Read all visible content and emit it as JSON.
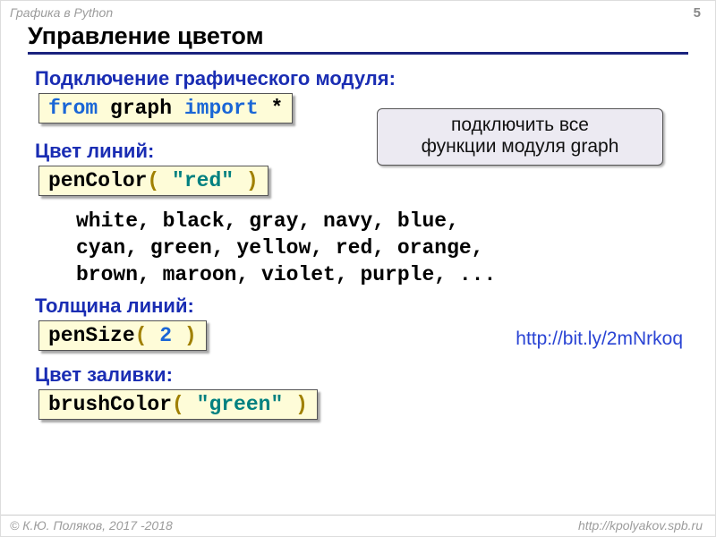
{
  "header": {
    "topic": "Графика в Python",
    "page": "5"
  },
  "title": "Управление цветом",
  "sections": {
    "connect": {
      "label": "Подключение графического модуля:",
      "code": {
        "a": "from",
        "b": " graph ",
        "c": "import",
        "d": " *"
      }
    },
    "callout": {
      "l1": "подключить все",
      "l2": "функции модуля graph"
    },
    "pencolor": {
      "label": "Цвет линий:",
      "code": {
        "a": "penColor",
        "b": "( ",
        "c": "\"red\"",
        "d": " )"
      }
    },
    "colors_block": "white, black, gray, navy, blue,\ncyan, green, yellow, red, orange,\nbrown, maroon, violet, purple, ...",
    "link": "http://bit.ly/2mNrkoq",
    "pensize": {
      "label": "Толщина линий:",
      "code": {
        "a": "penSize",
        "b": "( ",
        "c": "2",
        "d": " )"
      }
    },
    "brush": {
      "label": "Цвет заливки:",
      "code": {
        "a": "brushColor",
        "b": "( ",
        "c": "\"green\"",
        "d": " )"
      }
    }
  },
  "footer": {
    "left": "© К.Ю. Поляков, 2017 -2018",
    "right": "http://kpolyakov.spb.ru"
  }
}
